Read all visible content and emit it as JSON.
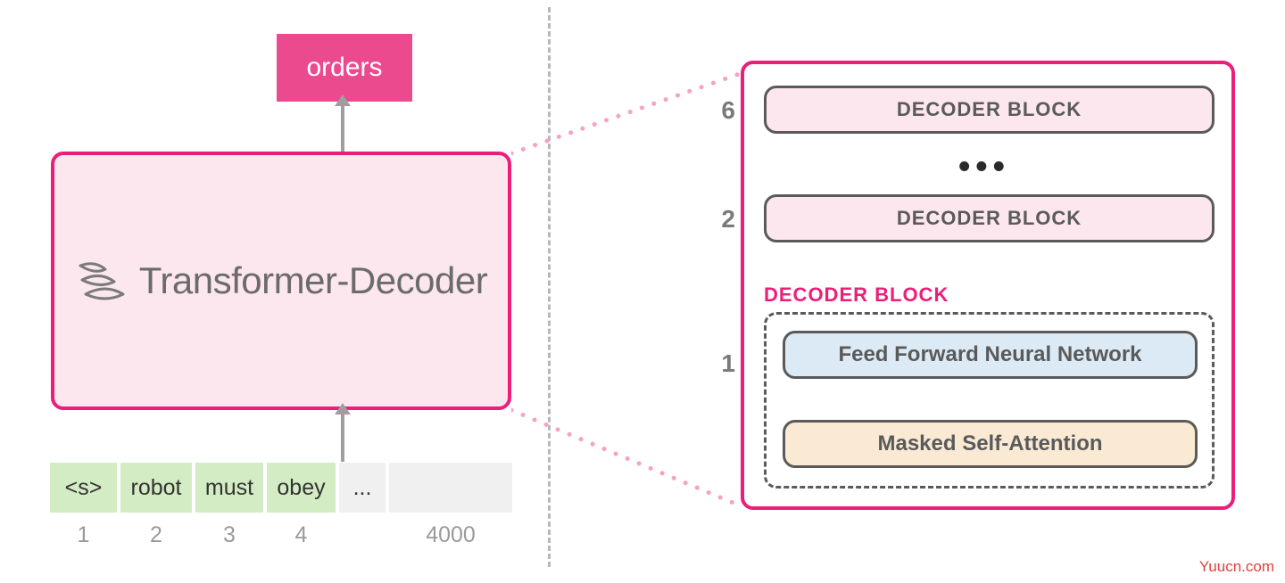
{
  "output": {
    "label": "orders"
  },
  "decoder": {
    "label": "Transformer-Decoder"
  },
  "tokens": [
    {
      "text": "<s>",
      "blank": false
    },
    {
      "text": "robot",
      "blank": false
    },
    {
      "text": "must",
      "blank": false
    },
    {
      "text": "obey",
      "blank": false
    },
    {
      "text": "...",
      "blank": true
    },
    {
      "text": "",
      "blank": true
    }
  ],
  "positions": [
    "1",
    "2",
    "3",
    "4",
    "",
    "4000"
  ],
  "right": {
    "num6": "6",
    "num2": "2",
    "num1": "1",
    "block_label": "DECODER BLOCK",
    "dots": "•••",
    "db_header": "DECODER BLOCK",
    "ffn": "Feed Forward Neural Network",
    "msa": "Masked Self-Attention"
  },
  "watermark": "Yuucn.com"
}
